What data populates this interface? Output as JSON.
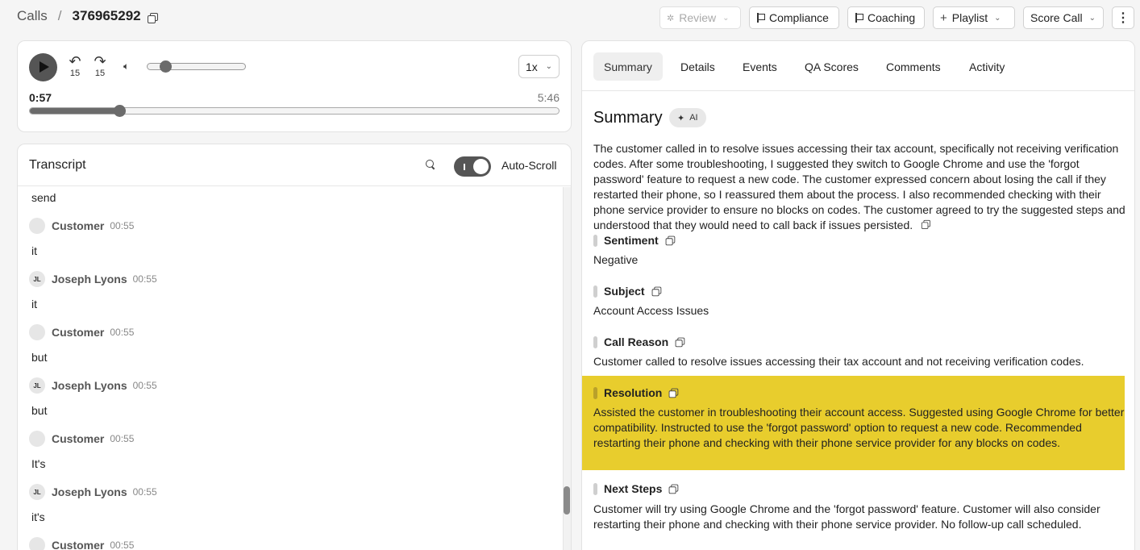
{
  "breadcrumb": {
    "section": "Calls",
    "separator": "/",
    "call_id": "376965292"
  },
  "header_buttons": {
    "review": "Review",
    "compliance": "Compliance",
    "coaching": "Coaching",
    "playlist": "Playlist",
    "score_call": "Score Call"
  },
  "player": {
    "skip_back": "15",
    "skip_forward": "15",
    "speed": "1x",
    "current_time": "0:57",
    "total_time": "5:46",
    "progress_fraction": 0.17,
    "volume_fraction": 0.18
  },
  "transcript": {
    "title": "Transcript",
    "auto_scroll_label": "Auto-Scroll",
    "auto_scroll_on": true,
    "entries": [
      {
        "kind": "text",
        "text": "send"
      },
      {
        "kind": "speaker",
        "initials": "",
        "name": "Customer",
        "time": "00:55"
      },
      {
        "kind": "text",
        "text": "it"
      },
      {
        "kind": "speaker",
        "initials": "JL",
        "name": "Joseph Lyons",
        "time": "00:55"
      },
      {
        "kind": "text",
        "text": "it"
      },
      {
        "kind": "speaker",
        "initials": "",
        "name": "Customer",
        "time": "00:55"
      },
      {
        "kind": "text",
        "text": "but"
      },
      {
        "kind": "speaker",
        "initials": "JL",
        "name": "Joseph Lyons",
        "time": "00:55"
      },
      {
        "kind": "text",
        "text": "but"
      },
      {
        "kind": "speaker",
        "initials": "",
        "name": "Customer",
        "time": "00:55"
      },
      {
        "kind": "text",
        "text": "It's"
      },
      {
        "kind": "speaker",
        "initials": "JL",
        "name": "Joseph Lyons",
        "time": "00:55"
      },
      {
        "kind": "text",
        "text": "it's"
      },
      {
        "kind": "speaker",
        "initials": "",
        "name": "Customer",
        "time": "00:55"
      }
    ]
  },
  "tabs": [
    "Summary",
    "Details",
    "Events",
    "QA Scores",
    "Comments",
    "Activity"
  ],
  "active_tab": "Summary",
  "summary": {
    "title": "Summary",
    "ai_badge": "AI",
    "text": "The customer called in to resolve issues accessing their tax account, specifically not receiving verification codes. After some troubleshooting, I suggested they switch to Google Chrome and use the 'forgot password' feature to request a new code. The customer expressed concern about losing the call if they restarted their phone, so I reassured them about the process. I also recommended checking with their phone service provider to ensure no blocks on codes. The customer agreed to try the suggested steps and understood that they would need to call back if issues persisted.",
    "sections": [
      {
        "label": "Sentiment",
        "value": "Negative"
      },
      {
        "label": "Subject",
        "value": "Account Access Issues"
      },
      {
        "label": "Call Reason",
        "value": "Customer called to resolve issues accessing their tax account and not receiving verification codes."
      },
      {
        "label": "Resolution",
        "value": "Assisted the customer in troubleshooting their account access. Suggested using Google Chrome for better compatibility. Instructed to use the 'forgot password' option to request a new code. Recommended restarting their phone and checking with their phone service provider for any blocks on codes."
      },
      {
        "label": "Next Steps",
        "value": "Customer will try using Google Chrome and the 'forgot password' feature. Customer will also consider restarting their phone and checking with their phone service provider. No follow-up call scheduled."
      }
    ]
  },
  "colors": {
    "highlight": "#e8cd2d",
    "accent_dark": "#555555"
  }
}
